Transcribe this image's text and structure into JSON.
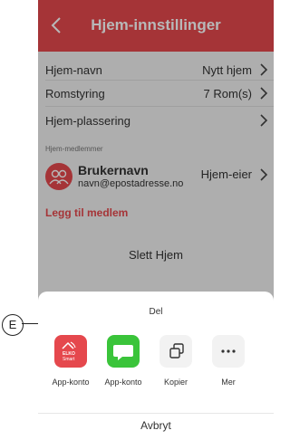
{
  "header": {
    "title": "Hjem-innstillinger"
  },
  "settings": {
    "rows": [
      {
        "label": "Hjem-navn",
        "value": "Nytt hjem"
      },
      {
        "label": "Romstyring",
        "value": "7 Rom(s)"
      },
      {
        "label": "Hjem-plassering",
        "value": ""
      }
    ],
    "members_section": "Hjem-medlemmer",
    "member": {
      "name": "Brukernavn",
      "email": "navn@epostadresse.no",
      "role": "Hjem-eier"
    },
    "add_member": "Legg til medlem",
    "delete_home": "Slett Hjem"
  },
  "share_sheet": {
    "title": "Del",
    "apps": [
      {
        "label": "App-konto",
        "icon": "elko-smart-icon",
        "badge": "ELKO Smart"
      },
      {
        "label": "App-konto",
        "icon": "chat-icon"
      },
      {
        "label": "Kopier",
        "icon": "copy-icon"
      },
      {
        "label": "Mer",
        "icon": "more-icon"
      }
    ],
    "cancel": "Avbryt"
  },
  "callout": {
    "label": "E"
  },
  "colors": {
    "accent": "#e5484d",
    "messages_green": "#3ac43a"
  }
}
